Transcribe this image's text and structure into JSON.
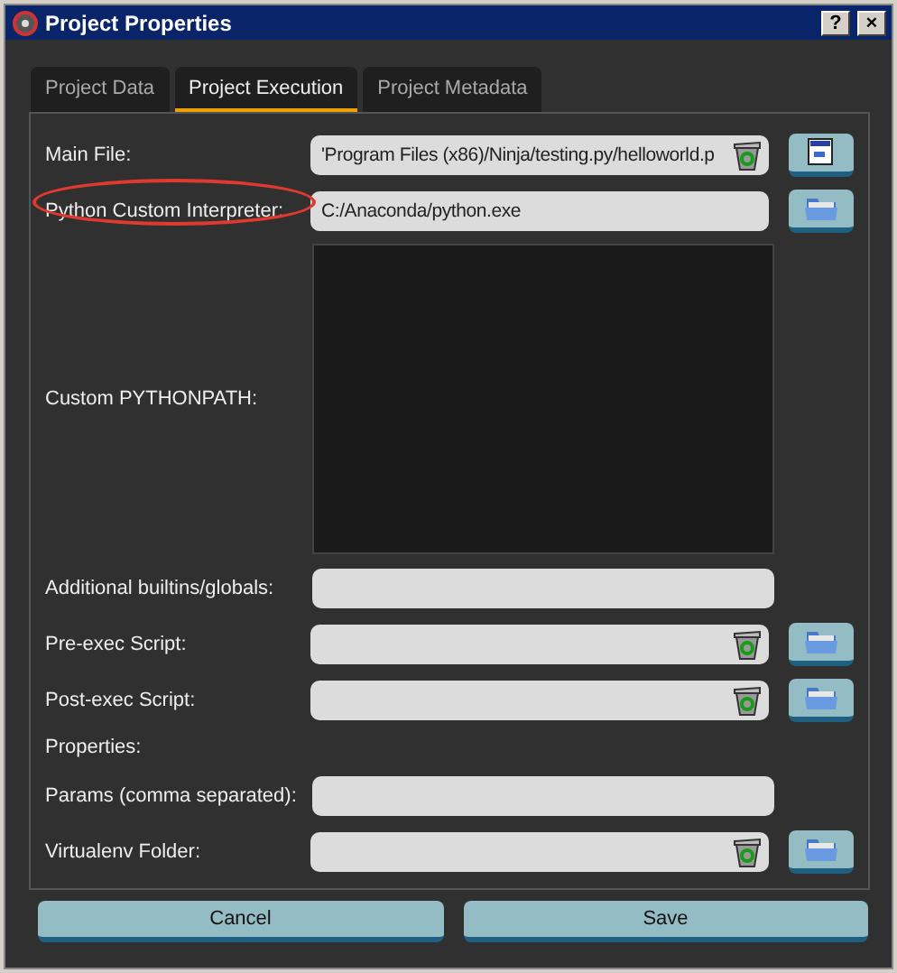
{
  "window": {
    "title": "Project Properties",
    "help_button": "?",
    "close_button": "×"
  },
  "tabs": [
    {
      "label": "Project Data",
      "selected": false
    },
    {
      "label": "Project Execution",
      "selected": true
    },
    {
      "label": "Project Metadata",
      "selected": false
    }
  ],
  "rows": [
    {
      "kind": "field",
      "label": "Main File:",
      "value": "'Program Files (x86)/Ninja/testing.py/helloworld.p",
      "clear": true,
      "browse": {
        "kind": "file"
      },
      "highlighted": false
    },
    {
      "kind": "field",
      "label": "Python Custom Interpreter:",
      "value": "C:/Anaconda/python.exe",
      "clear": false,
      "browse": {
        "kind": "folder"
      },
      "highlighted": true
    },
    {
      "kind": "textarea",
      "label": "Custom PYTHONPATH:",
      "highlighted": false
    },
    {
      "kind": "field",
      "label": "Additional builtins/globals:",
      "clear": false,
      "highlighted": false
    },
    {
      "kind": "field",
      "label": "Pre-exec Script:",
      "clear": true,
      "browse": {
        "kind": "folder"
      },
      "highlighted": false
    },
    {
      "kind": "field",
      "label": "Post-exec Script:",
      "clear": true,
      "browse": {
        "kind": "folder"
      },
      "highlighted": false
    },
    {
      "kind": "heading",
      "label": "Properties:",
      "highlighted": false
    },
    {
      "kind": "field",
      "label": "Params (comma separated):",
      "clear": false,
      "highlighted": false
    },
    {
      "kind": "field",
      "label": "Virtualenv Folder:",
      "clear": true,
      "browse": {
        "kind": "folder"
      },
      "highlighted": false
    }
  ],
  "buttons": [
    "Cancel",
    "Save"
  ]
}
